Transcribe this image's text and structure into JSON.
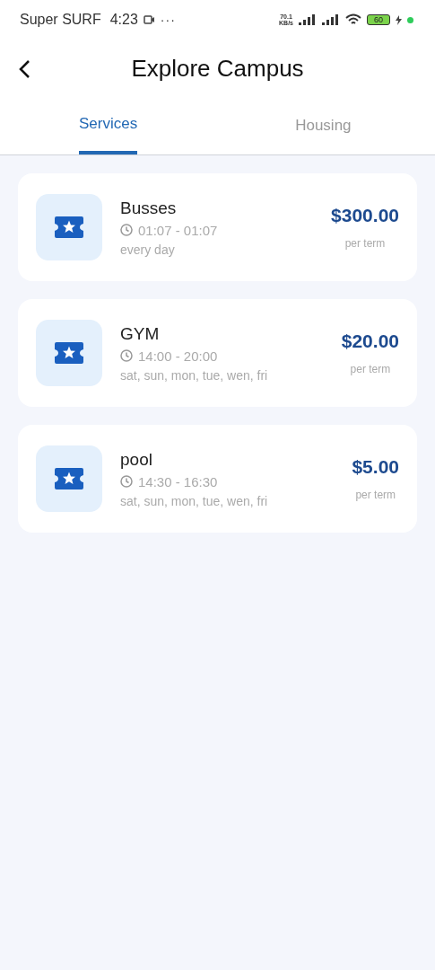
{
  "status_bar": {
    "carrier": "Super SURF",
    "time": "4:23",
    "more": "···",
    "speed_value": "70.1",
    "speed_unit": "KB/s",
    "battery": "60"
  },
  "header": {
    "title": "Explore Campus"
  },
  "tabs": [
    {
      "label": "Services",
      "selected": true
    },
    {
      "label": "Housing",
      "selected": false
    }
  ],
  "services": [
    {
      "name": "Busses",
      "hours": "01:07 - 01:07",
      "days": "every day",
      "price": "$300.00",
      "period": "per term"
    },
    {
      "name": "GYM",
      "hours": "14:00 - 20:00",
      "days": "sat, sun, mon, tue, wen, fri",
      "price": "$20.00",
      "period": "per term"
    },
    {
      "name": "pool",
      "hours": "14:30 - 16:30",
      "days": "sat, sun, mon, tue, wen, fri",
      "price": "$5.00",
      "period": "per term"
    }
  ]
}
